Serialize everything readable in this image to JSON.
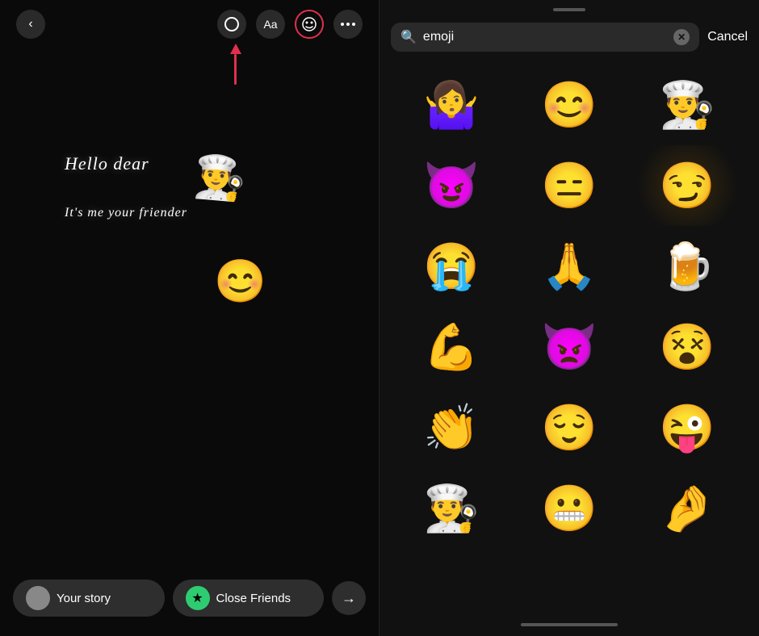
{
  "left": {
    "back_icon": "‹",
    "text_icon": "Aa",
    "sticker_icon": "☺",
    "more_icon": "•••",
    "story_text_1": "Hello dear",
    "story_text_2": "It's me your friender",
    "emoji_1": "👨‍🍳",
    "emoji_2": "😊",
    "bottom": {
      "your_story_label": "Your story",
      "close_friends_label": "Close Friends",
      "send_icon": "→",
      "green_icon": "★"
    }
  },
  "right": {
    "search_placeholder": "emoji",
    "cancel_label": "Cancel",
    "emojis": [
      "🤷‍♀️",
      "😊",
      "👨‍🍳",
      "😈",
      "😑",
      "😏",
      "😭",
      "🙏",
      "🍺",
      "💪",
      "👿",
      "😵",
      "👏",
      "😌",
      "😜",
      "👨‍🍳",
      "😬",
      "🤌"
    ],
    "glow_index": 5
  }
}
